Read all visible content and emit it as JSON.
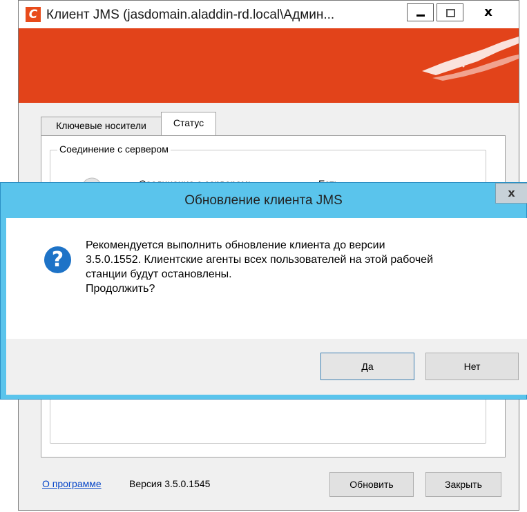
{
  "main_window": {
    "app_icon_letter": "C",
    "title": "Клиент JMS (jasdomain.aladdin-rd.local\\Админ...",
    "close_glyph": "x",
    "tabs": [
      {
        "label": "Ключевые носители"
      },
      {
        "label": "Статус"
      }
    ],
    "group_title": "Соединение с сервером",
    "connection_label": "Соединение с сервером:",
    "connection_value": "Есть",
    "about_link": "О программе",
    "version": "Версия 3.5.0.1545",
    "update_button": "Обновить",
    "close_button": "Закрыть",
    "brand_color": "#e2431a"
  },
  "dialog": {
    "title": "Обновление клиента JMS",
    "close_glyph": "x",
    "icon": "question-icon",
    "icon_glyph": "?",
    "message_lines": [
      "Рекомендуется выполнить обновление клиента до версии",
      "3.5.0.1552. Клиентские агенты всех пользователей на этой рабочей",
      "станции будут остановлены.",
      "Продолжить?"
    ],
    "yes_button": "Да",
    "no_button": "Нет",
    "accent_color": "#5ac4ec"
  }
}
